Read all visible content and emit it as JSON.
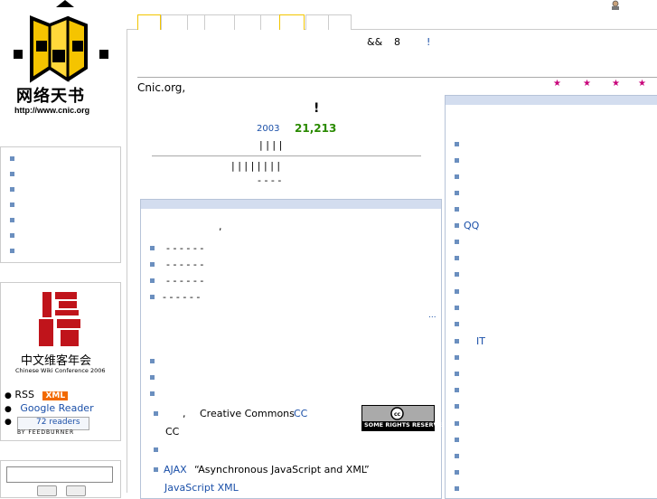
{
  "site": {
    "logo_caption": "网络天书",
    "logo_url": "http://www.cnic.org",
    "notice_prefix": "&&",
    "notice_number": "8",
    "notice_mark": "!",
    "intro": "Cnic.org,"
  },
  "stats": {
    "headline_mark": "!",
    "since_year": "2003",
    "count": "21,213",
    "row1": "|     |     |     |",
    "row2": "|     |     |     |     |     |     |     |",
    "row3": "-     -     -     -"
  },
  "main_panel": {
    "comma": ",",
    "dash_rows": [
      "-  -  -  -  -  -",
      "-  -  -  -  -  -",
      "-  -  -  -  -  -",
      "-   -  -  -  -  -"
    ],
    "more": "...",
    "license_comma": ",",
    "license_text": "Creative Commons",
    "license_cc_link": "CC",
    "license_cc_line2": "CC",
    "cc_badge_text": "SOME RIGHTS RESERVED",
    "ajax_link": "AJAX",
    "ajax_text": "“Asynchronous JavaScript and XML”",
    "ajax_line2": "JavaScript XML"
  },
  "right_panel": {
    "qq_link": "QQ",
    "it_link": "IT"
  },
  "wiki_conf": {
    "zh": "中文维客年会",
    "en": "Chinese Wiki Conference 2006"
  },
  "feeds": {
    "rss": "RSS",
    "xml_badge": "XML",
    "google": "Google",
    "reader": "Reader",
    "readers": "72  readers",
    "burner": "BY FEEDBURNER"
  },
  "colors": {
    "accent_blue": "#1a4fa8",
    "green": "#2a8a00",
    "star": "#c8007a",
    "xml_orange": "#f26a00"
  }
}
